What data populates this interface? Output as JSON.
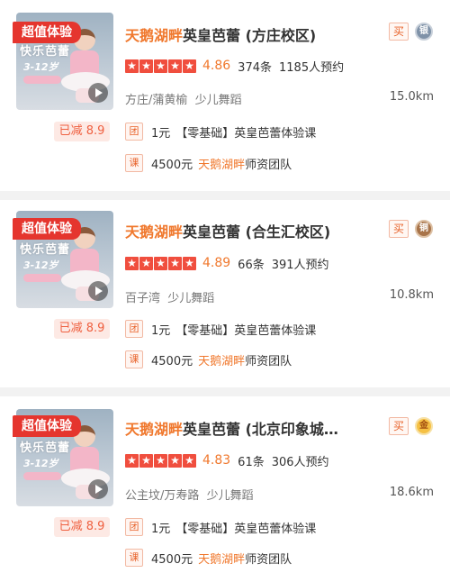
{
  "listings": [
    {
      "badge": "超值体验",
      "thumb_title": "快乐芭蕾",
      "thumb_age": "3-12岁",
      "name_brand": "天鹅湖畔",
      "name_rest": "英皇芭蕾 (方庄校区)",
      "buy_label": "买",
      "medal": "银",
      "stars": [
        "★",
        "★",
        "★",
        "★",
        "★"
      ],
      "score": "4.86",
      "reviews": "374条",
      "bookings": "1185人预约",
      "area": "方庄/蒲黄榆",
      "category": "少儿舞蹈",
      "distance": "15.0km",
      "discount": "已减 8.9",
      "deal1_tag": "团",
      "deal1_price": "1元",
      "deal1_text": "【零基础】英皇芭蕾体验课",
      "deal2_tag": "课",
      "deal2_price": "4500元",
      "deal2_brand": "天鹅湖畔",
      "deal2_text": "师资团队"
    },
    {
      "badge": "超值体验",
      "thumb_title": "快乐芭蕾",
      "thumb_age": "3-12岁",
      "name_brand": "天鹅湖畔",
      "name_rest": "英皇芭蕾 (合生汇校区)",
      "buy_label": "买",
      "medal": "铜",
      "stars": [
        "★",
        "★",
        "★",
        "★",
        "★"
      ],
      "score": "4.89",
      "reviews": "66条",
      "bookings": "391人预约",
      "area": "百子湾",
      "category": "少儿舞蹈",
      "distance": "10.8km",
      "discount": "已减 8.9",
      "deal1_tag": "团",
      "deal1_price": "1元",
      "deal1_text": "【零基础】英皇芭蕾体验课",
      "deal2_tag": "课",
      "deal2_price": "4500元",
      "deal2_brand": "天鹅湖畔",
      "deal2_text": "师资团队"
    },
    {
      "badge": "超值体验",
      "thumb_title": "快乐芭蕾",
      "thumb_age": "3-12岁",
      "name_brand": "天鹅湖畔",
      "name_rest": "英皇芭蕾 (北京印象城…",
      "buy_label": "买",
      "medal": "金",
      "stars": [
        "★",
        "★",
        "★",
        "★",
        "★"
      ],
      "score": "4.83",
      "reviews": "61条",
      "bookings": "306人预约",
      "area": "公主坟/万寿路",
      "category": "少儿舞蹈",
      "distance": "18.6km",
      "discount": "已减 8.9",
      "deal1_tag": "团",
      "deal1_price": "1元",
      "deal1_text": "【零基础】英皇芭蕾体验课",
      "deal2_tag": "课",
      "deal2_price": "4500元",
      "deal2_brand": "天鹅湖畔",
      "deal2_text": "师资团队"
    }
  ],
  "colors": {
    "brand": "#f0782d",
    "badge": "#e5352e",
    "star": "#f04e3e",
    "discount_bg": "#fde9e4",
    "separator": "#f2f2f2"
  }
}
